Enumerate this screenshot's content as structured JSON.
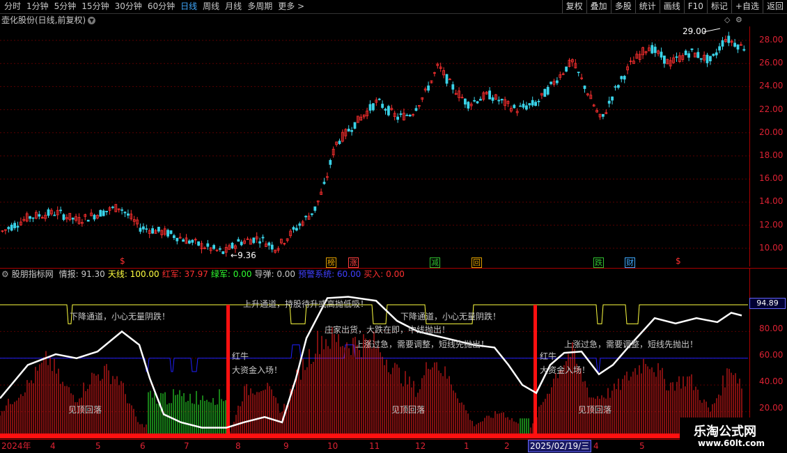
{
  "toolbar": {
    "periods": [
      "分时",
      "1分钟",
      "5分钟",
      "15分钟",
      "30分钟",
      "60分钟",
      "日线",
      "周线",
      "月线",
      "多周期",
      "更多 >"
    ],
    "active_period": "日线",
    "tools": [
      "复权",
      "叠加",
      "多股",
      "统计",
      "画线",
      "F10",
      "标记",
      "+自选",
      "返回"
    ]
  },
  "chart": {
    "title": "壶化股份(日线,前复权)",
    "high_label": "29.00",
    "low_label": "9.36",
    "price_ticks": [
      "28.00",
      "26.00",
      "24.00",
      "22.00",
      "20.00",
      "18.00",
      "16.00",
      "14.00",
      "12.00",
      "10.00"
    ],
    "signals": [
      {
        "text": "榜",
        "color": "#e0a000"
      },
      {
        "text": "涨",
        "color": "#ff4040"
      },
      {
        "text": "减",
        "color": "#30c030"
      },
      {
        "text": "回",
        "color": "#e0a000"
      },
      {
        "text": "跌",
        "color": "#30c030"
      },
      {
        "text": "财",
        "color": "#3fa9ff"
      }
    ],
    "dollar_marks": [
      "$",
      "$"
    ]
  },
  "indicator": {
    "name": "股朋指标网",
    "fields": [
      {
        "label": "情报:",
        "value": "91.30",
        "color": "#c8c8c8"
      },
      {
        "label": "天线:",
        "value": "100.00",
        "color": "#ffff40"
      },
      {
        "label": "红军:",
        "value": "37.97",
        "color": "#ff3030"
      },
      {
        "label": "绿军:",
        "value": "0.00",
        "color": "#30ff30"
      },
      {
        "label": "导弹:",
        "value": "0.00",
        "color": "#c8c8c8"
      },
      {
        "label": "预警系统:",
        "value": "60.00",
        "color": "#4040ff"
      },
      {
        "label": "买入:",
        "value": "0.00",
        "color": "#ff3030"
      }
    ],
    "ticks": [
      "80.00",
      "60.00",
      "40.00",
      "20.00"
    ],
    "current_value": "94.89",
    "annotations": [
      {
        "text": "下降通道，小心无量阴跌！",
        "color": "#ffffff"
      },
      {
        "text": "上升通道，持股待升或高抛低吸！",
        "color": "#ffffff"
      },
      {
        "text": "下降通道，小心无量阴跌！",
        "color": "#ffffff"
      },
      {
        "text": "庄家出货，大跌在即，中线抛出！",
        "color": "#30ff30"
      },
      {
        "text": "上涨过急，需要调整，短线先抛出！",
        "color": "#ff3030"
      },
      {
        "text": "上涨过急，需要调整，短线先抛出！",
        "color": "#ff3030"
      },
      {
        "text": "红牛",
        "color": "#ffffff"
      },
      {
        "text": "大资金入场！",
        "color": "#ffff40"
      },
      {
        "text": "红牛",
        "color": "#ffffff"
      },
      {
        "text": "大资金入场！",
        "color": "#ffff40"
      },
      {
        "text": "见顶回落",
        "color": "#ffffff"
      },
      {
        "text": "见顶回落",
        "color": "#ffffff"
      },
      {
        "text": "见顶回落",
        "color": "#ffffff"
      }
    ]
  },
  "dates": {
    "labels": [
      "2024年",
      "4",
      "5",
      "6",
      "7",
      "8",
      "9",
      "10",
      "11",
      "12",
      "1",
      "2",
      "4",
      "5"
    ],
    "selected": "2025/02/19/三"
  },
  "watermark": {
    "line1": "乐淘公式网",
    "line2": "www.60lt.com"
  }
}
